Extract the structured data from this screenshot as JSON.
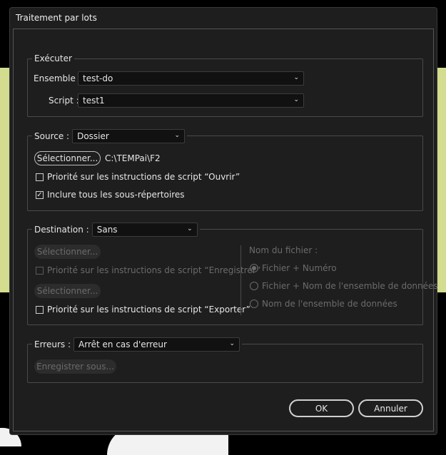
{
  "dialog": {
    "title": "Traitement par lots"
  },
  "executer": {
    "legend": "Exécuter",
    "ensemble_label": "Ensemble :",
    "ensemble_value": "test-do",
    "script_label": "Script :",
    "script_value": "test1"
  },
  "source": {
    "legend_label": "Source :",
    "value": "Dossier",
    "select_button": "Sélectionner...",
    "path": "C:\\TEMPai\\F2",
    "override_open_label": "Priorité sur les instructions de script “Ouvrir”",
    "override_open_checked": false,
    "include_subfolders_label": "Inclure tous les sous-répertoires",
    "include_subfolders_checked": true
  },
  "destination": {
    "legend_label": "Destination :",
    "value": "Sans",
    "select_button": "Sélectionner...",
    "override_save_label": "Priorité sur les instructions de script “Enregistrer”",
    "select_button2": "Sélectionner...",
    "override_export_label": "Priorité sur les instructions de script “Exporter”",
    "filename_label": "Nom du fichier :",
    "options": [
      {
        "label": "Fichier + Numéro",
        "selected": true
      },
      {
        "label": "Fichier + Nom de l'ensemble de données",
        "selected": false
      },
      {
        "label": "Nom de l'ensemble de données",
        "selected": false
      }
    ]
  },
  "errors": {
    "legend_label": "Erreurs :",
    "value": "Arrêt en cas d'erreur",
    "save_as_button": "Enregistrer sous..."
  },
  "footer": {
    "ok": "OK",
    "cancel": "Annuler"
  },
  "colors": {
    "lime": "#d3dc8f",
    "dialog_bg": "#1e1e1e",
    "disabled_text": "#6b6b6b"
  }
}
